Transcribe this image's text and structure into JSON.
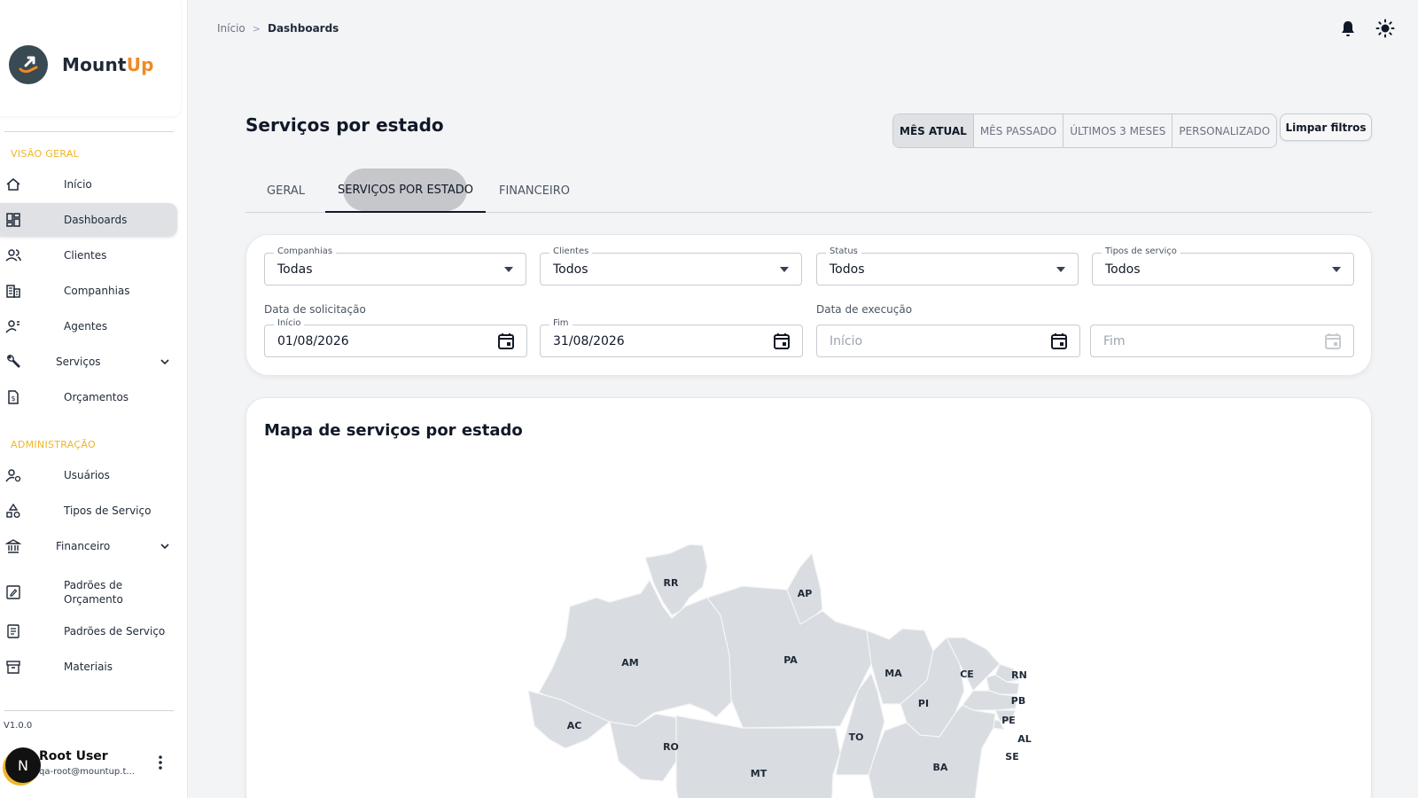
{
  "app": {
    "brand_part1": "Mount",
    "brand_part2": "Up",
    "brand_color": "#f08a24",
    "accent_color": "#f0b429"
  },
  "sidebar": {
    "sections": [
      {
        "label": "VISÃO GERAL",
        "items": [
          {
            "label": "Início",
            "icon": "home-icon"
          },
          {
            "label": "Dashboards",
            "icon": "dashboard-icon",
            "active": true
          },
          {
            "label": "Clientes",
            "icon": "clients-icon"
          },
          {
            "label": "Companhias",
            "icon": "building-icon"
          },
          {
            "label": "Agentes",
            "icon": "agents-icon"
          },
          {
            "label": "Serviços",
            "icon": "wrench-icon",
            "expandable": true
          },
          {
            "label": "Orçamentos",
            "icon": "budget-icon"
          }
        ]
      },
      {
        "label": "ADMINISTRAÇÃO",
        "items": [
          {
            "label": "Usuários",
            "icon": "user-settings-icon"
          },
          {
            "label": "Tipos de Serviço",
            "icon": "shapes-icon"
          },
          {
            "label": "Financeiro",
            "icon": "bank-icon",
            "expandable": true
          },
          {
            "label": "Padrões de Orçamento",
            "icon": "edit-doc-icon"
          },
          {
            "label": "Padrões de Serviço",
            "icon": "list-doc-icon"
          },
          {
            "label": "Materiais",
            "icon": "archive-icon"
          }
        ]
      }
    ],
    "version": "V1.0.0",
    "user": {
      "initial": "N",
      "name": "Root User",
      "email": "qa-root@mountup.t..."
    }
  },
  "breadcrumb": {
    "home": "Início",
    "separator": ">",
    "current": "Dashboards"
  },
  "header": {
    "title": "Serviços por estado",
    "periods": [
      {
        "label": "MÊS ATUAL",
        "selected": true
      },
      {
        "label": "MÊS PASSADO"
      },
      {
        "label": "ÚLTIMOS 3 MESES"
      },
      {
        "label": "PERSONALIZADO"
      }
    ],
    "clear_filters": "Limpar filtros"
  },
  "tabs": [
    {
      "label": "GERAL"
    },
    {
      "label": "SERVIÇOS POR ESTADO",
      "active": true
    },
    {
      "label": "FINANCEIRO"
    }
  ],
  "filters": {
    "selects": [
      {
        "label": "Companhias",
        "value": "Todas"
      },
      {
        "label": "Clientes",
        "value": "Todos"
      },
      {
        "label": "Status",
        "value": "Todos"
      },
      {
        "label": "Tipos de serviço",
        "value": "Todos"
      }
    ],
    "request_date": {
      "label": "Data de solicitação",
      "start_label": "Início",
      "start_value": "01/08/2026",
      "end_label": "Fim",
      "end_value": "31/08/2026"
    },
    "execution_date": {
      "label": "Data de execução",
      "start_placeholder": "Início",
      "end_placeholder": "Fim"
    }
  },
  "map": {
    "title": "Mapa de serviços por estado",
    "states": [
      "RR",
      "AP",
      "AM",
      "PA",
      "MA",
      "CE",
      "RN",
      "PB",
      "PI",
      "PE",
      "AL",
      "SE",
      "AC",
      "RO",
      "TO",
      "MT",
      "BA"
    ],
    "fill_color": "#d9dce1",
    "highlight_color": "#f08a24"
  }
}
